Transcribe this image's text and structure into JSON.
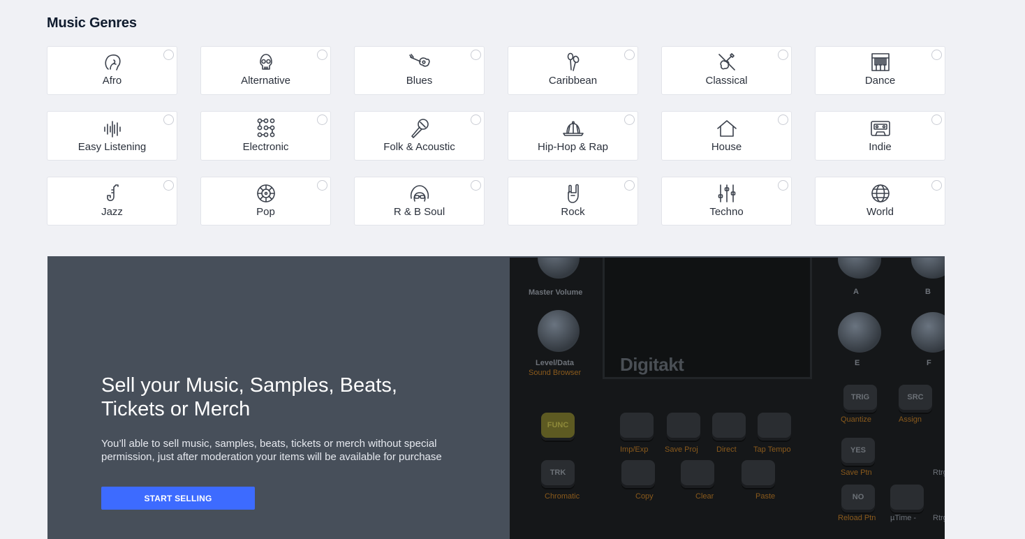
{
  "section": {
    "title": "Music Genres"
  },
  "genres": [
    {
      "label": "Afro",
      "icon": "afro-head-icon"
    },
    {
      "label": "Alternative",
      "icon": "skull-icon"
    },
    {
      "label": "Blues",
      "icon": "guitar-icon"
    },
    {
      "label": "Caribbean",
      "icon": "maracas-icon"
    },
    {
      "label": "Classical",
      "icon": "violin-icon"
    },
    {
      "label": "Dance",
      "icon": "piano-keys-icon"
    },
    {
      "label": "Easy Listening",
      "icon": "soundwave-icon"
    },
    {
      "label": "Electronic",
      "icon": "launchpad-icon"
    },
    {
      "label": "Folk & Acoustic",
      "icon": "microphone-icon"
    },
    {
      "label": "Hip-Hop & Rap",
      "icon": "cap-icon"
    },
    {
      "label": "House",
      "icon": "house-icon"
    },
    {
      "label": "Indie",
      "icon": "cassette-icon"
    },
    {
      "label": "Jazz",
      "icon": "saxophone-icon"
    },
    {
      "label": "Pop",
      "icon": "vinyl-icon"
    },
    {
      "label": "R & B  Soul",
      "icon": "afro-sunglasses-icon"
    },
    {
      "label": "Rock",
      "icon": "rock-hand-icon"
    },
    {
      "label": "Techno",
      "icon": "mixer-sliders-icon"
    },
    {
      "label": "World",
      "icon": "globe-icon"
    }
  ],
  "promo": {
    "heading": "Sell your Music, Samples, Beats, Tickets or Merch",
    "text": "You’ll able to sell music, samples, beats, tickets or merch without special permission, just after moderation your items will be available for purchase",
    "button": "START SELLING"
  },
  "device_photo": {
    "brand": "Digitakt",
    "labels": {
      "master_volume": "Master Volume",
      "level_data": "Level/Data",
      "sound_browser": "Sound Browser",
      "a": "A",
      "b": "B",
      "e": "E",
      "f": "F",
      "quantize": "Quantize",
      "assign": "Assign",
      "imp_exp": "Imp/Exp",
      "save_proj": "Save Proj",
      "direct": "Direct",
      "tap_tempo": "Tap Tempo",
      "save_ptn": "Save Ptn",
      "chromatic": "Chromatic",
      "copy": "Copy",
      "clear": "Clear",
      "paste": "Paste",
      "reload_ptn": "Reload Ptn",
      "utime": "µTime -",
      "rtrg1": "Rtrg",
      "rtrg2": "Rtrg"
    },
    "keys": {
      "func": "FUNC",
      "trk": "TRK",
      "trig": "TRIG",
      "src": "SRC",
      "yes": "YES",
      "no": "NO"
    }
  }
}
